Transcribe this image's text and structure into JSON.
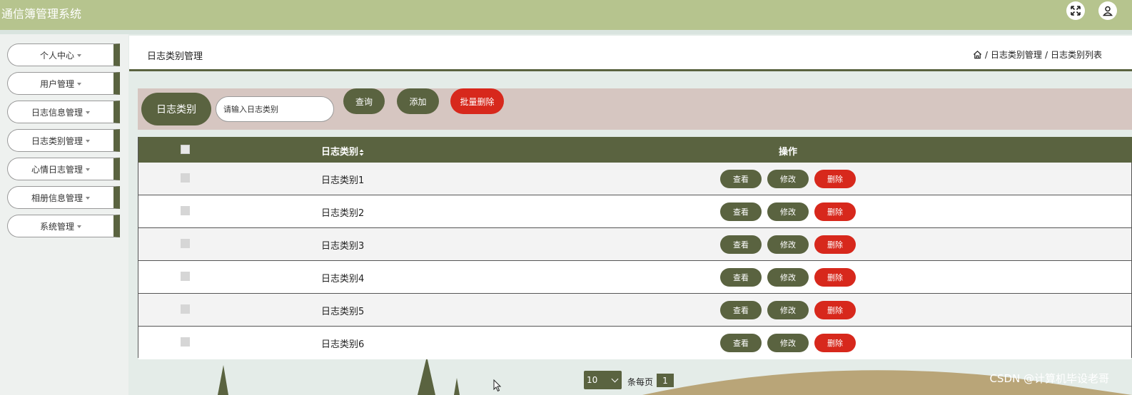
{
  "app": {
    "title": "通信簿管理系统"
  },
  "topbar": {
    "icons": [
      "fullscreen-icon",
      "user-icon"
    ]
  },
  "sidebar": {
    "items": [
      {
        "label": "个人中心"
      },
      {
        "label": "用户管理"
      },
      {
        "label": "日志信息管理"
      },
      {
        "label": "日志类别管理"
      },
      {
        "label": "心情日志管理"
      },
      {
        "label": "相册信息管理"
      },
      {
        "label": "系统管理"
      }
    ]
  },
  "header": {
    "title": "日志类别管理",
    "breadcrumb": [
      "日志类别管理",
      "日志类别列表"
    ]
  },
  "search": {
    "label": "日志类别",
    "placeholder": "请输入日志类别",
    "query_button": "查询",
    "add_button": "添加",
    "batch_delete_button": "批量删除"
  },
  "table": {
    "columns": {
      "category": "日志类别",
      "actions": "操作"
    },
    "rows": [
      {
        "name": "日志类别1"
      },
      {
        "name": "日志类别2"
      },
      {
        "name": "日志类别3"
      },
      {
        "name": "日志类别4"
      },
      {
        "name": "日志类别5"
      },
      {
        "name": "日志类别6"
      }
    ],
    "actions": {
      "view": "查看",
      "edit": "修改",
      "delete": "删除"
    }
  },
  "pagination": {
    "page_size": "10",
    "per_page_label": "条每页",
    "current_page": "1"
  },
  "watermark": "CSDN @计算机毕设老哥",
  "colors": {
    "topbar": "#b6c48e",
    "olive": "#5a6340",
    "danger": "#d7281c",
    "search_bar_bg": "#d6c6c1"
  }
}
